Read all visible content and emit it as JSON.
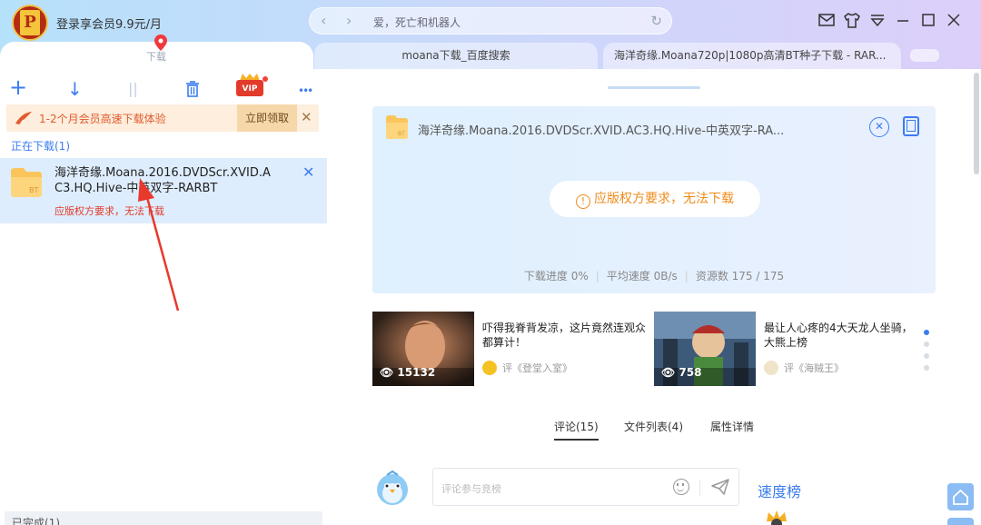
{
  "header": {
    "user_promo": "登录享会员9.9元/月",
    "address": "爱，死亡和机器人"
  },
  "tabs": {
    "download": "下载",
    "items": [
      {
        "label": "moana下载_百度搜索"
      },
      {
        "label": "海洋奇缘.Moana720p|1080p高清BT种子下载 - RAR..."
      }
    ]
  },
  "toolbar": {
    "add": "+",
    "download": "↓",
    "pause": "||",
    "delete": "🗑",
    "vip": "VIP",
    "more": "•••"
  },
  "promo": {
    "text": "1-2个月会员高速下载体验",
    "claim": "立即领取",
    "close": "✕"
  },
  "downloading": {
    "label": "正在下载(1)",
    "item": {
      "title": "海洋奇缘.Moana.2016.DVDScr.XVID.AC3.HQ.Hive-中英双字-RARBT",
      "status": "应版权方要求，无法下载",
      "close": "✕"
    }
  },
  "completed": {
    "label": "已完成(1)"
  },
  "detail": {
    "title": "海洋奇缘.Moana.2016.DVDScr.XVID.AC3.HQ.Hive-中英双字-RA...",
    "warning": "应版权方要求，无法下载",
    "warn_icon": "!",
    "close_icon": "✕",
    "stats": {
      "progress": "下载进度 0%",
      "speed": "平均速度 0B/s",
      "resources": "资源数 175 / 175"
    }
  },
  "recommendations": [
    {
      "views": "15132",
      "title": "吓得我脊背发凉，这片竟然连观众都算计！",
      "source": "评《登堂入室》"
    },
    {
      "views": "758",
      "title": "最让人心疼的4大天龙人坐骑，大熊上榜",
      "source": "评《海贼王》"
    }
  ],
  "subtabs": {
    "comments": "评论(15)",
    "files": "文件列表(4)",
    "props": "属性详情"
  },
  "comment": {
    "placeholder": "评论参与竞榜",
    "speed_rank": "速度榜"
  },
  "icons": {
    "eye": "👁"
  },
  "colors": {
    "accent": "#3c7cf0",
    "warning": "#ef8b1c",
    "error": "#e23b2b",
    "promo_bg": "#fdeedd"
  }
}
